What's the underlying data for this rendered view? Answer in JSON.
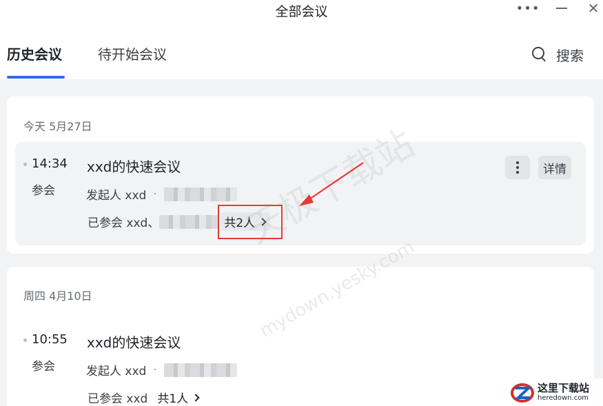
{
  "window": {
    "title": "全部会议",
    "more_glyph": "•••",
    "close_glyph": "✕"
  },
  "tabs": [
    {
      "label": "历史会议",
      "active": true
    },
    {
      "label": "待开始会议",
      "active": false
    }
  ],
  "search": {
    "label": "搜索",
    "icon": "search-icon"
  },
  "groups": [
    {
      "date": "今天 5月27日",
      "meeting": {
        "time": "14:34",
        "role": "参会",
        "title": "xxd的快速会议",
        "organizer_prefix": "发起人 xxd",
        "separator": "·",
        "attendees_prefix": "已参会 xxd、",
        "attendee_count": "共2人",
        "more_icon": "vertical-ellipsis-icon",
        "detail_label": "详情"
      }
    },
    {
      "date": "周四 4月10日",
      "meeting": {
        "time": "10:55",
        "role": "参会",
        "title": "xxd的快速会议",
        "organizer_prefix": "发起人 xxd",
        "separator": "·",
        "attendees_prefix": "已参会 xxd",
        "attendee_count": "共1人"
      }
    }
  ],
  "watermark": {
    "main": "天极下载站",
    "sub": "mydown.yesky.com"
  },
  "site_logo": {
    "name": "这里下载站",
    "url_text": "heredown.com"
  },
  "colors": {
    "accent": "#2f6ce6",
    "annotation": "#e53935",
    "page_bg": "#f2f3f5"
  }
}
